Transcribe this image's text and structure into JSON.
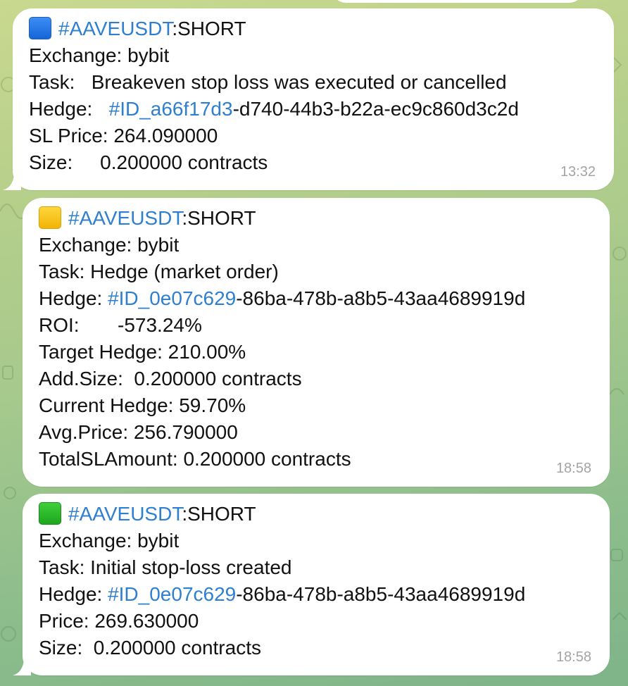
{
  "messages": [
    {
      "icon": "blue-square-icon",
      "tag": "#AAVEUSDT",
      "side": ":SHORT",
      "lines": [
        {
          "text": "Exchange: bybit"
        },
        {
          "text": "Task:   Breakeven stop loss was executed or cancelled"
        },
        {
          "label": "Hedge:   ",
          "link": "#ID_a66f17d3",
          "rest": "-d740-44b3-b22a-ec9c860d3c2d"
        },
        {
          "text": "SL Price: 264.090000"
        },
        {
          "text": "Size:     0.200000 contracts"
        }
      ],
      "time": "13:32"
    },
    {
      "icon": "yellow-square-icon",
      "tag": "#AAVEUSDT",
      "side": ":SHORT",
      "lines": [
        {
          "text": "Exchange: bybit"
        },
        {
          "text": "Task: Hedge (market order)"
        },
        {
          "label": "Hedge: ",
          "link": "#ID_0e07c629",
          "rest": "-86ba-478b-a8b5-43aa4689919d"
        },
        {
          "text": "ROI:       -573.24%"
        },
        {
          "text": "Target Hedge: 210.00%"
        },
        {
          "text": "Add.Size:  0.200000 contracts"
        },
        {
          "text": "Current Hedge: 59.70%"
        },
        {
          "text": "Avg.Price: 256.790000"
        },
        {
          "text": "TotalSLAmount: 0.200000 contracts"
        }
      ],
      "time": "18:58"
    },
    {
      "icon": "green-square-icon",
      "tag": "#AAVEUSDT",
      "side": ":SHORT",
      "lines": [
        {
          "text": "Exchange: bybit"
        },
        {
          "text": "Task: Initial stop-loss created"
        },
        {
          "label": "Hedge: ",
          "link": "#ID_0e07c629",
          "rest": "-86ba-478b-a8b5-43aa4689919d"
        },
        {
          "text": "Price: 269.630000"
        },
        {
          "text": "Size:  0.200000 contracts"
        }
      ],
      "time": "18:58"
    }
  ],
  "colors": {
    "link": "#2f7fd0",
    "bubble": "#ffffff",
    "timestamp": "#a4a4a4"
  }
}
